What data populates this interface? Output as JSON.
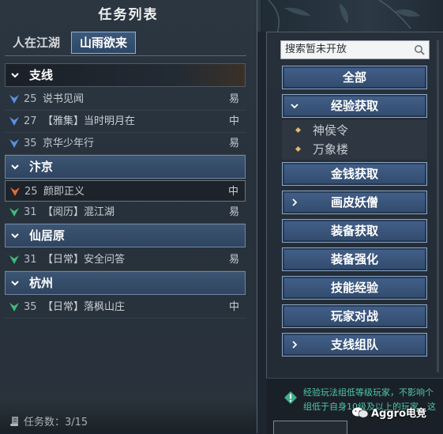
{
  "left_panel": {
    "title": "任务列表",
    "tabs": [
      {
        "label": "人在江湖",
        "active": false
      },
      {
        "label": "山雨欲来",
        "active": true
      }
    ],
    "groups": [
      {
        "name": "支线",
        "quests": [
          {
            "level": "25",
            "name": "说书见闻",
            "difficulty": "易",
            "marker": "blue-chevron"
          },
          {
            "level": "27",
            "name": "【雅集】当时明月在",
            "difficulty": "中",
            "marker": "blue-chevron"
          },
          {
            "level": "35",
            "name": "京华少年行",
            "difficulty": "易",
            "marker": "blue-chevron"
          }
        ]
      },
      {
        "name": "汴京",
        "quests": [
          {
            "level": "25",
            "name": "颜即正义",
            "difficulty": "中",
            "marker": "orange-chevron"
          },
          {
            "level": "31",
            "name": "【阅历】混江湖",
            "difficulty": "易",
            "marker": "green-chevron"
          }
        ]
      },
      {
        "name": "仙居原",
        "quests": [
          {
            "level": "31",
            "name": "【日常】安全问答",
            "difficulty": "易",
            "marker": "green-chevron"
          }
        ]
      },
      {
        "name": "杭州",
        "quests": [
          {
            "level": "35",
            "name": "【日常】落枫山庄",
            "difficulty": "中",
            "marker": "green-chevron"
          }
        ]
      }
    ],
    "footer": {
      "label": "任务数：3/15"
    }
  },
  "right_panel": {
    "search_placeholder": "搜索暂未开放",
    "categories": [
      {
        "label": "全部",
        "chevron": "none"
      },
      {
        "label": "经验获取",
        "chevron": "down"
      },
      {
        "label": "金钱获取",
        "chevron": "none"
      },
      {
        "label": "画皮妖僧",
        "chevron": "right"
      },
      {
        "label": "装备获取",
        "chevron": "none"
      },
      {
        "label": "装备强化",
        "chevron": "none"
      },
      {
        "label": "技能经验",
        "chevron": "none"
      },
      {
        "label": "玩家对战",
        "chevron": "none"
      },
      {
        "label": "支线组队",
        "chevron": "right"
      }
    ],
    "sub_items": [
      "神侯令",
      "万象楼"
    ],
    "info_lines": [
      "经验玩法组低等级玩家，不影响个",
      "组低于自身10级及以上的玩家，这"
    ]
  },
  "watermark": {
    "label": "Aggro电竞"
  },
  "colors": {
    "marker_blue": "#5b8fe0",
    "marker_orange": "#e46a3a",
    "marker_green": "#3dbb79",
    "button_fill": "#3b5678",
    "info_text": "#4fc6a9"
  }
}
